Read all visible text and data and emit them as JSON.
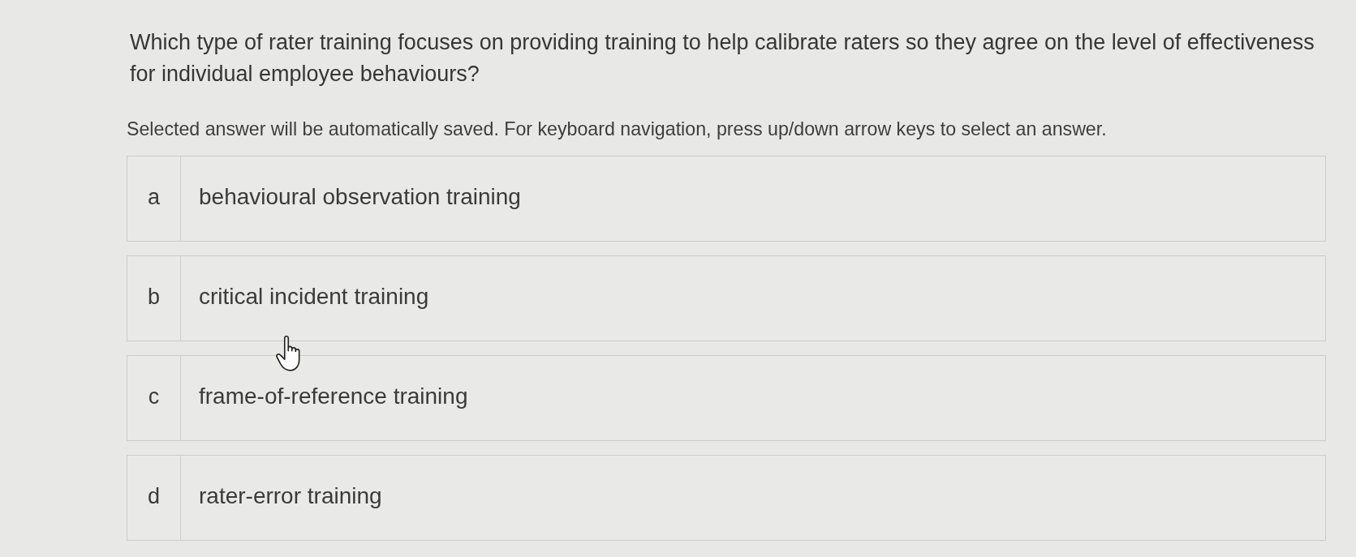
{
  "question": {
    "text": "Which type of rater training focuses on providing training to help calibrate raters so they agree on the level of effectiveness for individual employee behaviours?",
    "instructions": "Selected answer will be automatically saved. For keyboard navigation, press up/down arrow keys to select an answer."
  },
  "options": [
    {
      "letter": "a",
      "text": "behavioural observation training",
      "selected": false
    },
    {
      "letter": "b",
      "text": "critical incident training",
      "selected": false
    },
    {
      "letter": "c",
      "text": "frame-of-reference training",
      "selected": false
    },
    {
      "letter": "d",
      "text": "rater-error training",
      "selected": false
    }
  ]
}
